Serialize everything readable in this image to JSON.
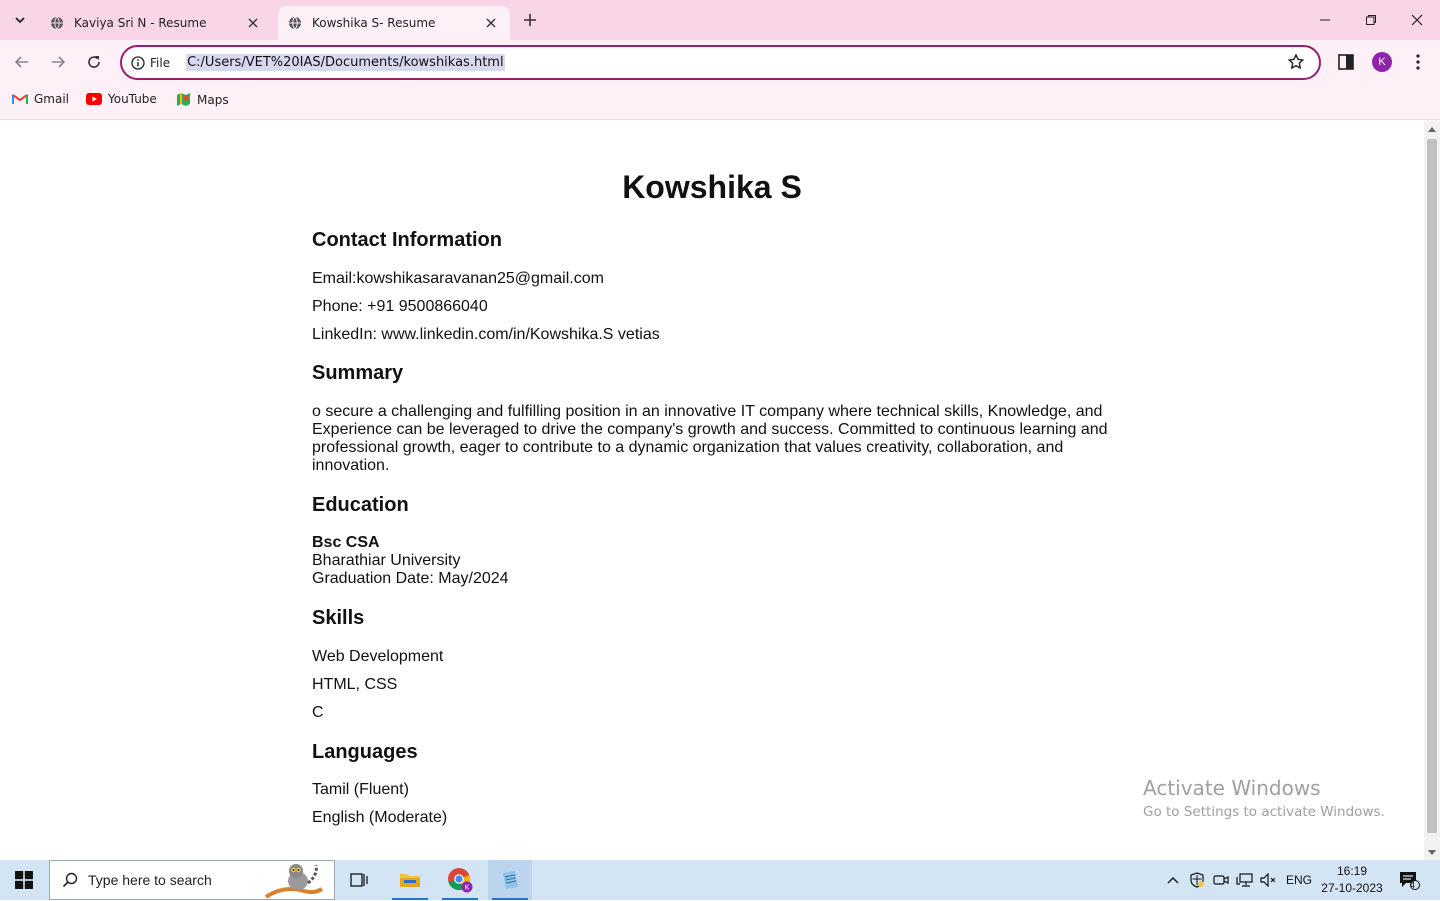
{
  "browser": {
    "tabs": [
      {
        "title": "Kaviya Sri N - Resume",
        "active": false
      },
      {
        "title": "Kowshika S- Resume",
        "active": true
      }
    ],
    "address": {
      "scheme_label": "File",
      "url": "C:/Users/VET%20IAS/Documents/kowshikas.html"
    },
    "profile_initial": "K",
    "bookmarks": [
      {
        "label": "Gmail",
        "icon": "gmail-icon"
      },
      {
        "label": "YouTube",
        "icon": "youtube-icon"
      },
      {
        "label": "Maps",
        "icon": "maps-icon"
      }
    ]
  },
  "resume": {
    "name": "Kowshika S",
    "contact_heading": "Contact Information",
    "email": "Email:kowshikasaravanan25@gmail.com",
    "phone": "Phone: +91 9500866040",
    "linkedin": "LinkedIn: www.linkedin.com/in/Kowshika.S vetias",
    "summary_heading": "Summary",
    "summary": "o secure a challenging and fulfilling position in an innovative IT company where technical skills, Knowledge, and Experience can be leveraged to drive the company's growth and success. Committed to continuous learning and professional growth, eager to contribute to a dynamic organization that values creativity, collaboration, and innovation.",
    "education_heading": "Education",
    "degree": "Bsc CSA",
    "university": "Bharathiar University",
    "graduation": "Graduation Date: May/2024",
    "skills_heading": "Skills",
    "skills": [
      "Web Development",
      "HTML, CSS",
      "C"
    ],
    "languages_heading": "Languages",
    "languages": [
      "Tamil (Fluent)",
      "English (Moderate)"
    ]
  },
  "watermark": {
    "line1": "Activate Windows",
    "line2": "Go to Settings to activate Windows."
  },
  "taskbar": {
    "search_placeholder": "Type here to search",
    "language": "ENG",
    "time": "16:19",
    "date": "27-10-2023",
    "notification_count": "4"
  },
  "colors": {
    "tabstrip": "#f9d5e8",
    "toolbar": "#fdf0f6",
    "omnibox_border": "#9b1c6c",
    "avatar": "#8e24aa",
    "taskbar": "#d3e4f5"
  }
}
